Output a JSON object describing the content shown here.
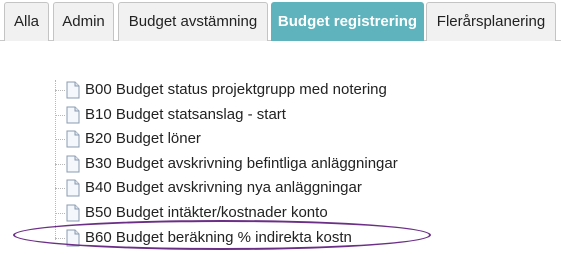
{
  "tabs": [
    {
      "label": "Alla",
      "active": false
    },
    {
      "label": "Admin",
      "active": false
    },
    {
      "label": "Budget avstämning",
      "active": false
    },
    {
      "label": "Budget registrering",
      "active": true
    },
    {
      "label": "Flerårsplanering",
      "active": false
    }
  ],
  "tree": {
    "items": [
      {
        "label": "B00 Budget status projektgrupp med notering",
        "icon": "document-icon"
      },
      {
        "label": "B10 Budget statsanslag - start",
        "icon": "document-icon"
      },
      {
        "label": "B20 Budget löner",
        "icon": "document-icon"
      },
      {
        "label": "B30 Budget avskrivning befintliga anläggningar",
        "icon": "document-icon"
      },
      {
        "label": "B40 Budget avskrivning nya anläggningar",
        "icon": "document-icon"
      },
      {
        "label": "B50 Budget intäkter/kostnader konto",
        "icon": "document-icon"
      },
      {
        "label": "B60 Budget beräkning % indirekta kostn",
        "icon": "document-icon"
      }
    ]
  },
  "colors": {
    "active_tab": "#5fb3bd",
    "highlight": "#6b2f86"
  }
}
